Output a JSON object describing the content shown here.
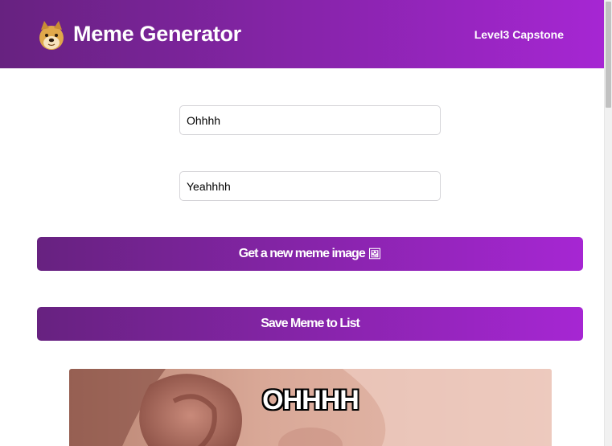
{
  "header": {
    "title": "Meme Generator",
    "subtitle": "Level3 Capstone",
    "logo_icon": "doge-icon"
  },
  "form": {
    "top_text_value": "Ohhhh",
    "bottom_text_value": "Yeahhhh"
  },
  "buttons": {
    "new_image_label": "Get a new meme image",
    "new_image_icon": "frame-picture-icon",
    "save_label": "Save Meme to List"
  },
  "meme": {
    "top_text": "Ohhhh"
  },
  "colors": {
    "gradient_start": "#672280",
    "gradient_end": "#a626d3"
  }
}
